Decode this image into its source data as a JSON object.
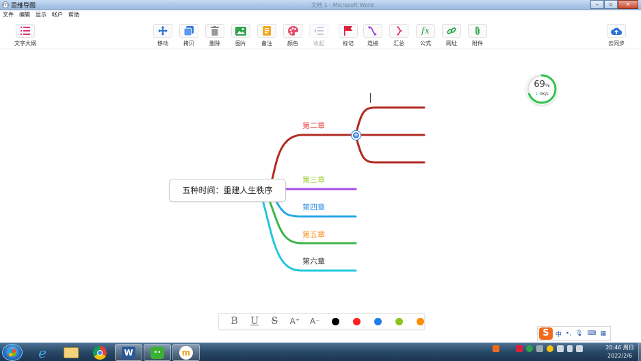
{
  "window": {
    "app_title": "思维导图",
    "background_title": "文档 1 - Microsoft Word",
    "controls": [
      "minimize",
      "maximize",
      "close"
    ]
  },
  "menu": [
    "文件",
    "编辑",
    "显示",
    "帐户",
    "帮助"
  ],
  "toolbar": {
    "outline_label": "文字大纲",
    "tools": [
      {
        "label": "移动",
        "icon": "move-icon"
      },
      {
        "label": "拷贝",
        "icon": "copy-icon"
      },
      {
        "label": "删除",
        "icon": "trash-icon"
      },
      {
        "label": "图片",
        "icon": "image-icon"
      },
      {
        "label": "备注",
        "icon": "note-icon"
      },
      {
        "label": "颜色",
        "icon": "palette-icon"
      },
      {
        "label": "收起",
        "icon": "collapse-icon",
        "disabled": true
      },
      {
        "label": "标记",
        "icon": "flag-icon"
      },
      {
        "label": "连接",
        "icon": "connect-icon"
      },
      {
        "label": "汇总",
        "icon": "summary-icon"
      },
      {
        "label": "公式",
        "icon": "formula-icon"
      },
      {
        "label": "网址",
        "icon": "link-icon"
      },
      {
        "label": "附件",
        "icon": "attachment-icon"
      }
    ],
    "cloud_label": "云同步"
  },
  "mindmap": {
    "root": "五种时间：重建人生秩序",
    "branches": [
      {
        "label": "第二章",
        "color": "#ee4040"
      },
      {
        "label": "第三章",
        "color": "#9bcf2e"
      },
      {
        "label": "第四章",
        "color": "#2e8ee6"
      },
      {
        "label": "第五章",
        "color": "#ff8c1a"
      },
      {
        "label": "第六章",
        "color": "#333333"
      }
    ],
    "line_colors": [
      "#b22b22",
      "#a64de8",
      "#29a8e8",
      "#3cb54a",
      "#22c8dc"
    ],
    "collapse_symbol": "+"
  },
  "speed_widget": {
    "percent": "69",
    "percent_unit": "%",
    "rate": "0K/s",
    "value": 0.69
  },
  "format_bar": {
    "buttons": [
      "B",
      "U",
      "S",
      "A⁺",
      "A⁻"
    ],
    "colors": [
      "#000000",
      "#ff2020",
      "#1e7ee8",
      "#8fc31f",
      "#ff8c00"
    ]
  },
  "ime": {
    "logo": "S",
    "mode": "中"
  },
  "taskbar": {
    "apps": [
      "ie",
      "explorer",
      "chrome",
      "word",
      "wechat",
      "mindmap"
    ],
    "time": "20:46 周日",
    "date": "2022/2/6"
  }
}
